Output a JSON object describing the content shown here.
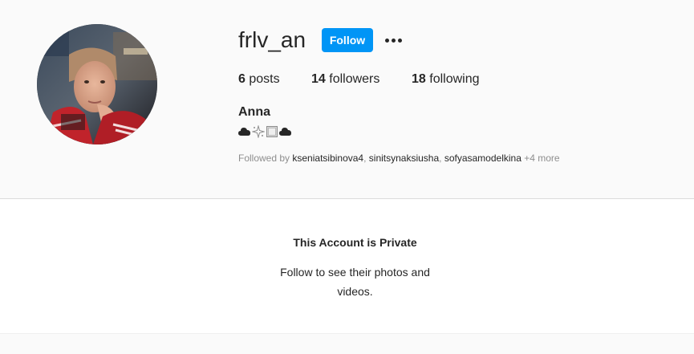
{
  "profile": {
    "username": "frlv_an",
    "follow_label": "Follow",
    "more_options_icon": "more-horizontal-icon",
    "stats": {
      "posts_count": "6",
      "posts_label": "posts",
      "followers_count": "14",
      "followers_label": "followers",
      "following_count": "18",
      "following_label": "following"
    },
    "full_name": "Anna",
    "bio_icons": [
      "cloud-icon",
      "sparkle-icon",
      "frame-icon",
      "cloud-icon"
    ],
    "followed_by": {
      "prefix": "Followed by",
      "accounts": [
        "kseniatsibinova4",
        "sinitsynaksiusha",
        "sofyasamodelkina"
      ],
      "separator": ", ",
      "more": "+4 more"
    }
  },
  "private_notice": {
    "title": "This Account is Private",
    "line1": "Follow to see their photos and",
    "line2": "videos."
  },
  "colors": {
    "accent": "#0095f6",
    "text": "#262626",
    "muted": "#8e8e8e",
    "background": "#fafafa",
    "panel": "#ffffff",
    "border": "#dbdbdb"
  }
}
